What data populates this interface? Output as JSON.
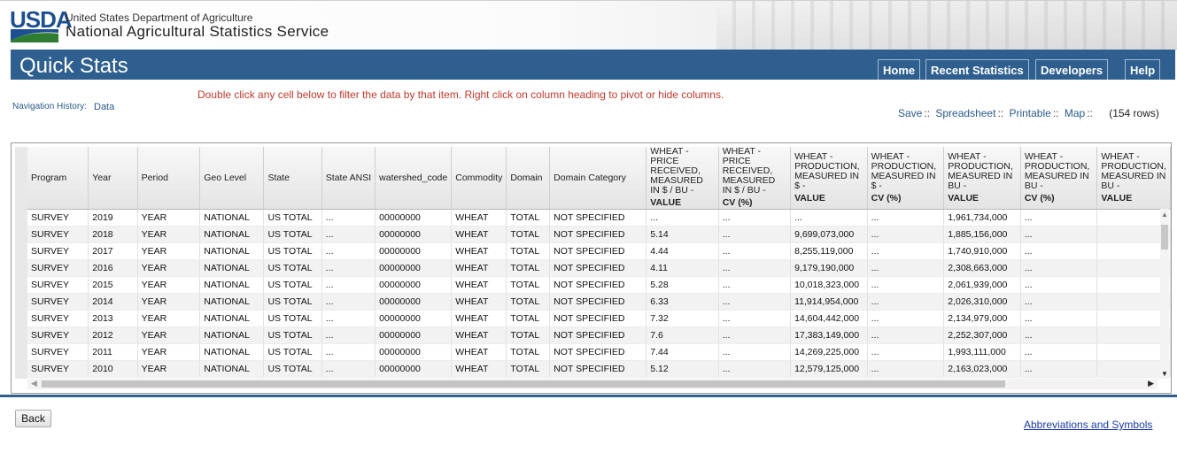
{
  "header": {
    "logo_text": "USDA",
    "agency_line1": "United States Department of Agriculture",
    "agency_line2": "National Agricultural Statistics Service"
  },
  "title": "Quick Stats",
  "nav": {
    "home": "Home",
    "recent": "Recent Statistics",
    "developers": "Developers",
    "help": "Help"
  },
  "instructions": "Double click any cell below to filter the data by that item. Right click on column heading to pivot or hide columns.",
  "navigation_history": {
    "label": "Navigation History:",
    "link": "Data"
  },
  "actions": {
    "save": "Save",
    "spreadsheet": "Spreadsheet",
    "printable": "Printable",
    "map": "Map",
    "separator": "::",
    "row_count": "(154 rows)"
  },
  "table": {
    "headers": [
      "Program",
      "Year",
      "Period",
      "Geo Level",
      "State",
      "State ANSI",
      "watershed_code",
      "Commodity",
      "Domain",
      "Domain Category"
    ],
    "value_headers": [
      {
        "text": "WHEAT - PRICE RECEIVED, MEASURED IN $ / BU",
        "sub": "VALUE"
      },
      {
        "text": "WHEAT - PRICE RECEIVED, MEASURED IN $ / BU",
        "sub": "CV (%)"
      },
      {
        "text": "WHEAT - PRODUCTION, MEASURED IN $",
        "sub": "VALUE"
      },
      {
        "text": "WHEAT - PRODUCTION, MEASURED IN $",
        "sub": "CV (%)"
      },
      {
        "text": "WHEAT - PRODUCTION, MEASURED IN BU",
        "sub": "VALUE"
      },
      {
        "text": "WHEAT - PRODUCTION, MEASURED IN BU",
        "sub": "CV (%)"
      },
      {
        "text": "WHEAT - PRODUCTION, MEASURED IN BU",
        "sub": "VALUE"
      }
    ],
    "rows": [
      [
        "SURVEY",
        "2019",
        "YEAR",
        "NATIONAL",
        "US TOTAL",
        "...",
        "00000000",
        "WHEAT",
        "TOTAL",
        "NOT SPECIFIED",
        "...",
        "...",
        "...",
        "...",
        "1,961,734,000",
        "...",
        ""
      ],
      [
        "SURVEY",
        "2018",
        "YEAR",
        "NATIONAL",
        "US TOTAL",
        "...",
        "00000000",
        "WHEAT",
        "TOTAL",
        "NOT SPECIFIED",
        "5.14",
        "...",
        "9,699,073,000",
        "...",
        "1,885,156,000",
        "...",
        ""
      ],
      [
        "SURVEY",
        "2017",
        "YEAR",
        "NATIONAL",
        "US TOTAL",
        "...",
        "00000000",
        "WHEAT",
        "TOTAL",
        "NOT SPECIFIED",
        "4.44",
        "...",
        "8,255,119,000",
        "...",
        "1,740,910,000",
        "...",
        ""
      ],
      [
        "SURVEY",
        "2016",
        "YEAR",
        "NATIONAL",
        "US TOTAL",
        "...",
        "00000000",
        "WHEAT",
        "TOTAL",
        "NOT SPECIFIED",
        "4.11",
        "...",
        "9,179,190,000",
        "...",
        "2,308,663,000",
        "...",
        ""
      ],
      [
        "SURVEY",
        "2015",
        "YEAR",
        "NATIONAL",
        "US TOTAL",
        "...",
        "00000000",
        "WHEAT",
        "TOTAL",
        "NOT SPECIFIED",
        "5.28",
        "...",
        "10,018,323,000",
        "...",
        "2,061,939,000",
        "...",
        ""
      ],
      [
        "SURVEY",
        "2014",
        "YEAR",
        "NATIONAL",
        "US TOTAL",
        "...",
        "00000000",
        "WHEAT",
        "TOTAL",
        "NOT SPECIFIED",
        "6.33",
        "...",
        "11,914,954,000",
        "...",
        "2,026,310,000",
        "...",
        ""
      ],
      [
        "SURVEY",
        "2013",
        "YEAR",
        "NATIONAL",
        "US TOTAL",
        "...",
        "00000000",
        "WHEAT",
        "TOTAL",
        "NOT SPECIFIED",
        "7.32",
        "...",
        "14,604,442,000",
        "...",
        "2,134,979,000",
        "...",
        ""
      ],
      [
        "SURVEY",
        "2012",
        "YEAR",
        "NATIONAL",
        "US TOTAL",
        "...",
        "00000000",
        "WHEAT",
        "TOTAL",
        "NOT SPECIFIED",
        "7.6",
        "...",
        "17,383,149,000",
        "...",
        "2,252,307,000",
        "...",
        ""
      ],
      [
        "SURVEY",
        "2011",
        "YEAR",
        "NATIONAL",
        "US TOTAL",
        "...",
        "00000000",
        "WHEAT",
        "TOTAL",
        "NOT SPECIFIED",
        "7.44",
        "...",
        "14,269,225,000",
        "...",
        "1,993,111,000",
        "...",
        ""
      ],
      [
        "SURVEY",
        "2010",
        "YEAR",
        "NATIONAL",
        "US TOTAL",
        "...",
        "00000000",
        "WHEAT",
        "TOTAL",
        "NOT SPECIFIED",
        "5.12",
        "...",
        "12,579,125,000",
        "...",
        "2,163,023,000",
        "...",
        ""
      ]
    ]
  },
  "footer": {
    "back": "Back",
    "abbreviations": "Abbreviations and Symbols"
  },
  "colors": {
    "brand_blue": "#2e5f8f",
    "usda_blue": "#1d4f91",
    "usda_green": "#2e7d32",
    "instruction_red": "#c0392b",
    "link": "#2a5a8c"
  }
}
